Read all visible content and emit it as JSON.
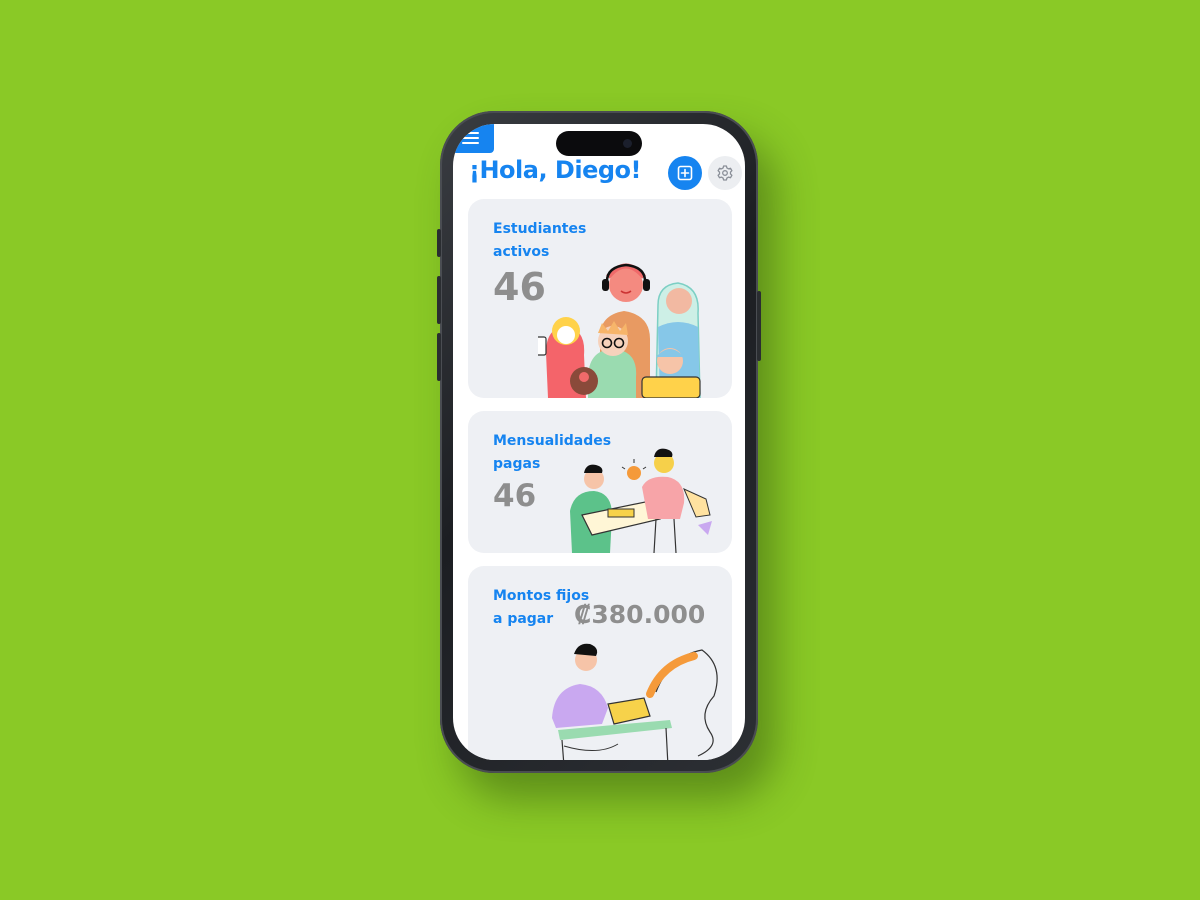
{
  "greeting": "¡Hola, Diego!",
  "colors": {
    "background": "#8AC926",
    "primary": "#1684F0",
    "card": "#EEF0F4",
    "value_text": "#8E8E8E"
  },
  "icons": {
    "menu": "hamburger-menu-icon",
    "add": "plus-square-icon",
    "settings": "gear-icon"
  },
  "cards": [
    {
      "title": "Estudiantes activos",
      "value": "46",
      "illustration": "group-of-students"
    },
    {
      "title": "Mensualidades pagas",
      "value": "46",
      "illustration": "payment-exchange"
    },
    {
      "title": "Montos fijos a pagar",
      "value": "₡380.000",
      "illustration": "person-at-register"
    }
  ]
}
